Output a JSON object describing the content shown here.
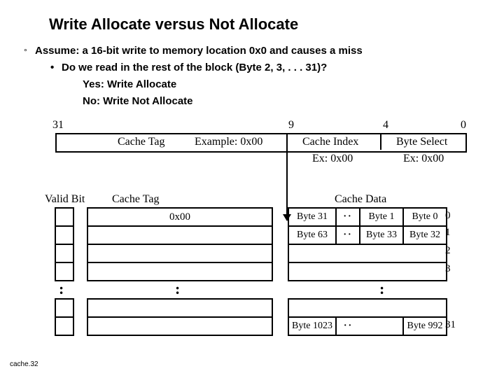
{
  "title": "Write Allocate versus Not Allocate",
  "bullets": {
    "assume": "Assume: a 16-bit write to memory location 0x0 and causes a miss",
    "do": "Do we read in the rest of the block (Byte 2, 3, . . . 31)?",
    "yes": "Yes: Write Allocate",
    "no": "No: Write Not Allocate"
  },
  "bits": {
    "b31": "31",
    "b9": "9",
    "b4": "4",
    "b0": "0"
  },
  "addr_labels": {
    "cache_tag": "Cache Tag",
    "example": "Example: 0x00",
    "cache_index": "Cache Index",
    "byte_select": "Byte Select",
    "ex_index": "Ex: 0x00",
    "ex_byte": "Ex: 0x00"
  },
  "columns": {
    "valid_bit": "Valid Bit",
    "cache_tag": "Cache Tag",
    "cache_data": "Cache Data"
  },
  "tag_row0": "0x00",
  "data": {
    "r0": {
      "a": "Byte 31",
      "c": "Byte 1",
      "d": "Byte 0"
    },
    "r1": {
      "a": "Byte 63",
      "c": "Byte 33",
      "d": "Byte 32"
    },
    "rlast": {
      "a": "Byte 1023",
      "d": "Byte 992"
    }
  },
  "dots_h": "··",
  "dots_v": ":",
  "row_nums": {
    "r0": "0",
    "r1": "1",
    "r2": "2",
    "r3": "3",
    "rlast": "31"
  },
  "footer": "cache.32"
}
